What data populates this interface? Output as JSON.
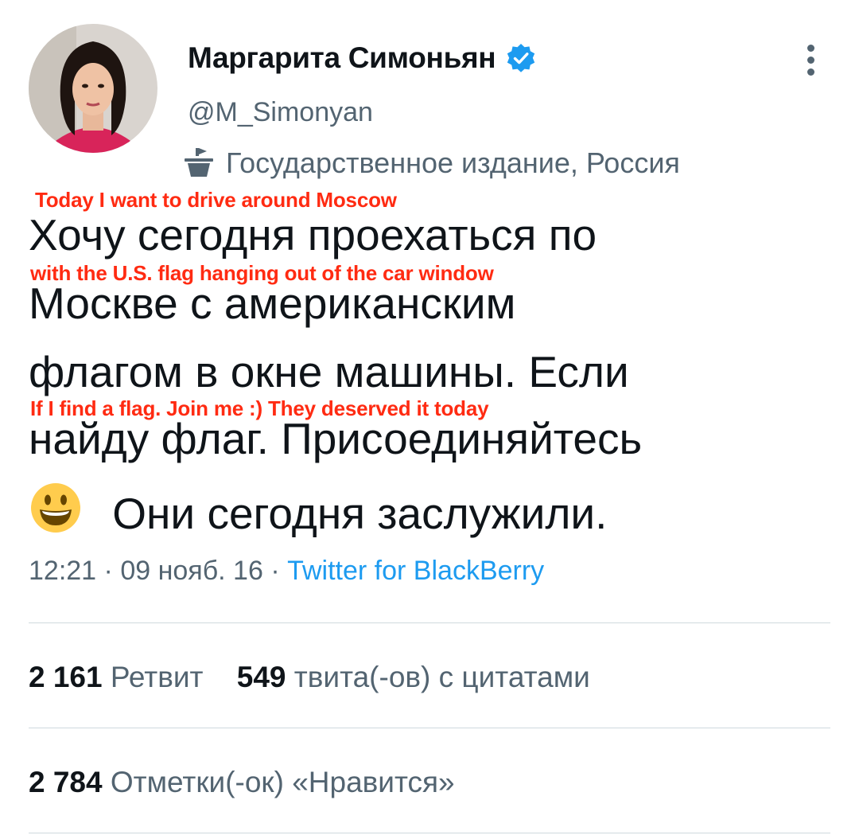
{
  "author": {
    "display_name": "Маргарита Симоньян",
    "handle": "@M_Simonyan",
    "label": "Государственное издание, Россия",
    "verified_color": "#1d9bf0"
  },
  "tweet": {
    "lines": [
      "Хочу сегодня проехаться по",
      "Москве с американским",
      "флагом в окне машины. Если",
      "найду флаг. Присоединяйтесь",
      "Они сегодня заслужили."
    ],
    "emoji": "smiling-face-icon"
  },
  "overlay_translation": [
    "Today I want to drive around Moscow",
    "with the U.S. flag hanging out of the car window",
    "If I find a flag. Join me :) They deserved it today"
  ],
  "meta": {
    "time": "12:21",
    "separator": "·",
    "date": "09 нояб. 16",
    "source": "Twitter for BlackBerry"
  },
  "stats": {
    "retweets_count": "2 161",
    "retweets_label": "Ретвит",
    "quotes_count": "549",
    "quotes_label": "твита(-ов) с цитатами",
    "likes_count": "2 784",
    "likes_label": "Отметки(-ок) «Нравится»"
  },
  "colors": {
    "overlay_text": "#ff2b12",
    "link": "#1d9bf0",
    "secondary_text": "#536471"
  }
}
